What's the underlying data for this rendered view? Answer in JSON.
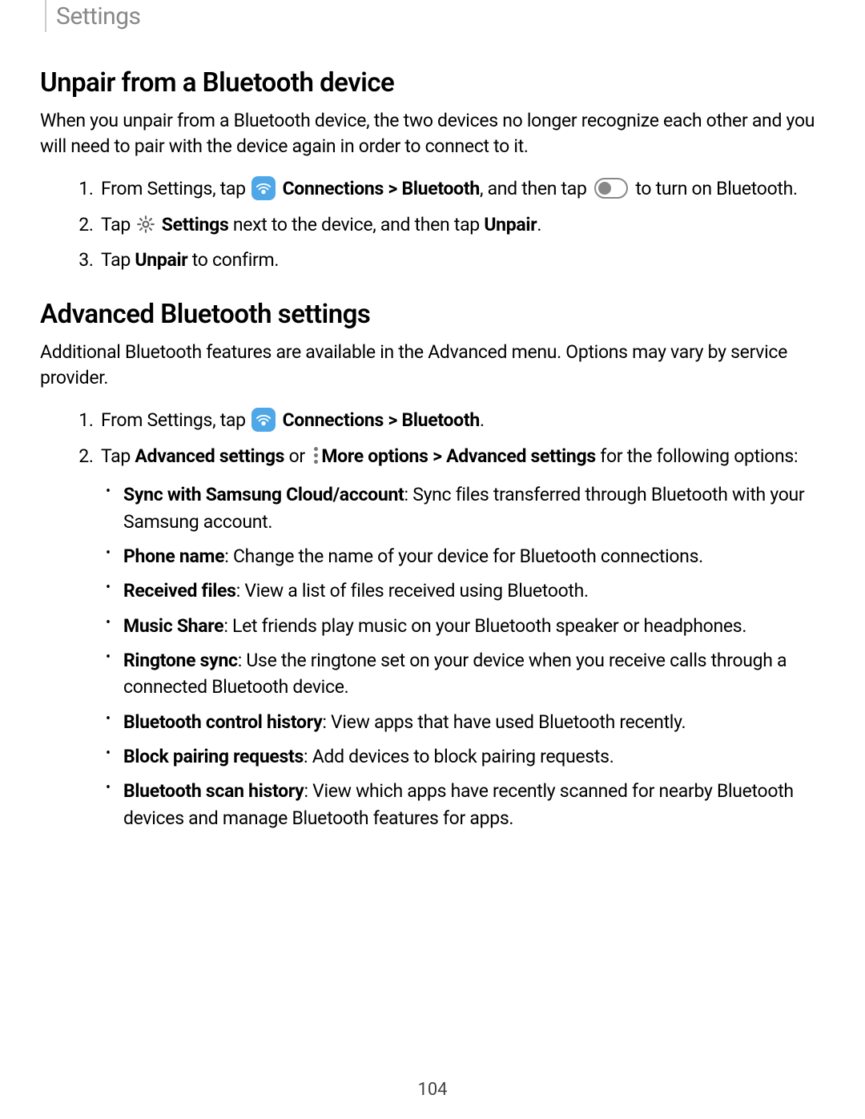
{
  "header": {
    "title": "Settings"
  },
  "section1": {
    "heading": "Unpair from a Bluetooth device",
    "intro": "When you unpair from a Bluetooth device, the two devices no longer recognize each other and you will need to pair with the device again in order to connect to it.",
    "steps": [
      {
        "pre": "From Settings, tap ",
        "conn": "Connections",
        "sep": " > ",
        "bt": "Bluetooth",
        "mid": ", and then tap ",
        "post": " to turn on Bluetooth."
      },
      {
        "pre": "Tap ",
        "settings": "Settings",
        "mid": " next to the device, and then tap ",
        "unpair": "Unpair",
        "post": "."
      },
      {
        "pre": "Tap ",
        "unpair": "Unpair",
        "post": " to confirm."
      }
    ]
  },
  "section2": {
    "heading": "Advanced Bluetooth settings",
    "intro": "Additional Bluetooth features are available in the Advanced menu. Options may vary by service provider.",
    "steps": [
      {
        "pre": "From Settings, tap ",
        "conn": "Connections",
        "sep": " > ",
        "bt": "Bluetooth",
        "post": "."
      },
      {
        "pre": "Tap ",
        "adv": "Advanced settings",
        "or": " or ",
        "more": "More options",
        "sep": " > ",
        "adv2": "Advanced settings",
        "post": " for the following options:"
      }
    ],
    "options": [
      {
        "b": "Sync with Samsung Cloud/account",
        "t": ": Sync files transferred through Bluetooth with your Samsung account."
      },
      {
        "b": "Phone name",
        "t": ": Change the name of your device for Bluetooth connections."
      },
      {
        "b": "Received files",
        "t": ": View a list of files received using Bluetooth."
      },
      {
        "b": "Music Share",
        "t": ": Let friends play music on your Bluetooth speaker or headphones."
      },
      {
        "b": "Ringtone sync",
        "t": ": Use the ringtone set on your device when you receive calls through a connected Bluetooth device."
      },
      {
        "b": "Bluetooth control history",
        "t": ": View apps that have used Bluetooth recently."
      },
      {
        "b": "Block pairing requests",
        "t": ": Add devices to block pairing requests."
      },
      {
        "b": "Bluetooth scan history",
        "t": ": View which apps have recently scanned for nearby Bluetooth devices and manage Bluetooth features for apps."
      }
    ]
  },
  "pageNumber": "104"
}
